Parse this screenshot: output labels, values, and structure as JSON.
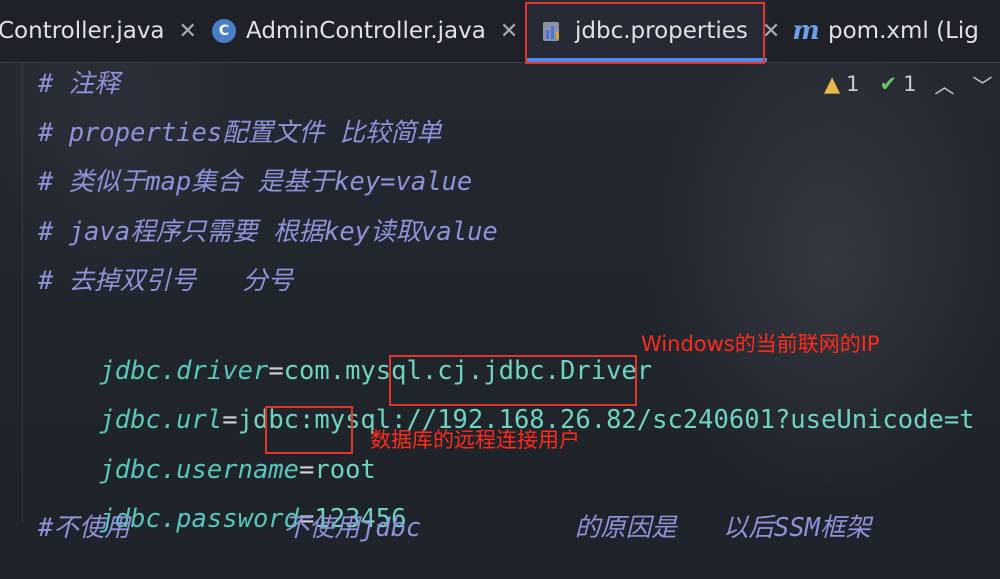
{
  "tabs": [
    {
      "label": "Controller.java",
      "icon": "java-class-icon",
      "active": false
    },
    {
      "label": "AdminController.java",
      "icon": "java-class-icon",
      "active": false
    },
    {
      "label": "jdbc.properties",
      "icon": "properties-file-icon",
      "active": true
    },
    {
      "label": "pom.xml (Lig",
      "icon": "maven-icon",
      "active": false
    }
  ],
  "inspection": {
    "warnings": "1",
    "weak_warnings": "1"
  },
  "code_lines": [
    {
      "type": "comment",
      "text": "# 注释"
    },
    {
      "type": "comment",
      "text": "# properties配置文件 比较简单"
    },
    {
      "type": "comment",
      "text": "# 类似于map集合 是基于key=value"
    },
    {
      "type": "comment",
      "text": "# java程序只需要 根据key读取value"
    },
    {
      "type": "comment",
      "text": "# 去掉双引号   分号"
    },
    {
      "type": "prop",
      "key": "jdbc.driver",
      "eq": "=",
      "value": "com.mysql.cj.jdbc.Driver"
    },
    {
      "type": "prop",
      "key": "jdbc.url",
      "eq": "=",
      "value": "jdbc:mysql://192.168.26.82/sc240601?useUnicode=t"
    },
    {
      "type": "prop",
      "key": "jdbc.username",
      "eq": "=",
      "value": "root"
    },
    {
      "type": "prop",
      "key": "jdbc.password",
      "eq": "=",
      "value": "123456"
    },
    {
      "type": "comment",
      "text": "#不使用          不使用jdbc          的原因是   以后SSM框架"
    }
  ],
  "annotations": {
    "ip_note": "Windows的当前联网的IP",
    "user_note": "数据库的远程连接用户"
  },
  "colors": {
    "accent_red": "#e0352b",
    "tab_active_underline": "#4c8cf0",
    "comment": "#8e93d8",
    "key": "#58c7b9"
  }
}
